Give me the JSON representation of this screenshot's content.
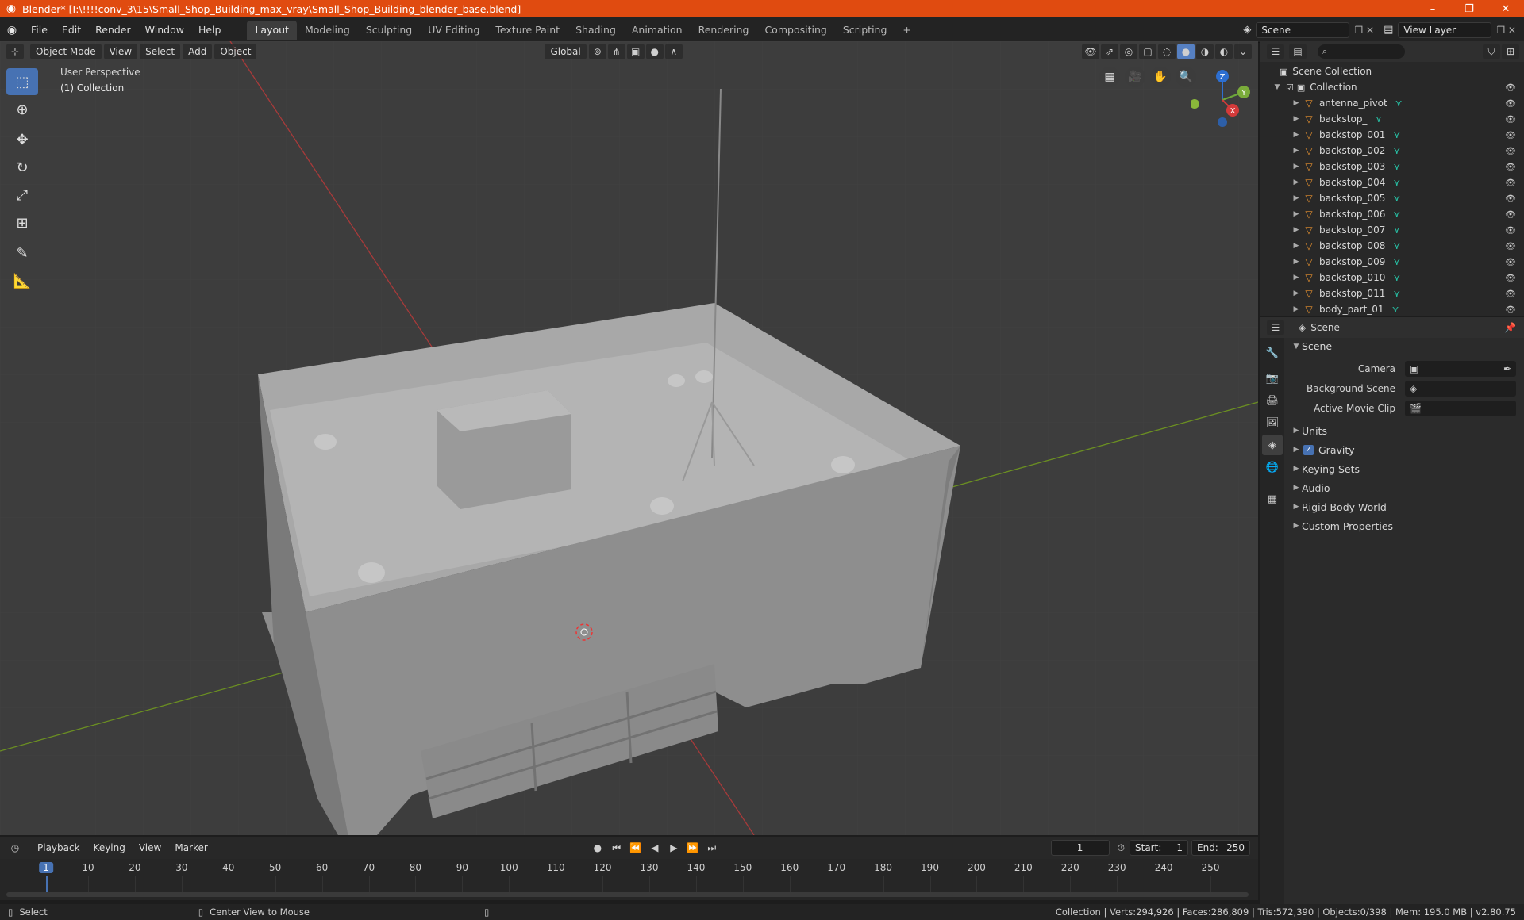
{
  "window": {
    "title": "Blender* [I:\\!!!!conv_3\\15\\Small_Shop_Building_max_vray\\Small_Shop_Building_blender_base.blend]",
    "min": "–",
    "max": "❐",
    "close": "✕"
  },
  "menu": [
    "File",
    "Edit",
    "Render",
    "Window",
    "Help"
  ],
  "workspaces": [
    "Layout",
    "Modeling",
    "Sculpting",
    "UV Editing",
    "Texture Paint",
    "Shading",
    "Animation",
    "Rendering",
    "Compositing",
    "Scripting"
  ],
  "workspace_add": "+",
  "scene_name": "Scene",
  "view_layer": "View Layer",
  "viewport": {
    "mode": "Object Mode",
    "menus": [
      "View",
      "Select",
      "Add",
      "Object"
    ],
    "transform": "Global",
    "perspective": "User Perspective",
    "collection_label": "(1) Collection"
  },
  "gizmo": {
    "x": "X",
    "y": "Y",
    "z": "Z"
  },
  "outliner": {
    "root": "Scene Collection",
    "collection": "Collection",
    "items": [
      "antenna_pivot",
      "backstop_",
      "backstop_001",
      "backstop_002",
      "backstop_003",
      "backstop_004",
      "backstop_005",
      "backstop_006",
      "backstop_007",
      "backstop_008",
      "backstop_009",
      "backstop_010",
      "backstop_011",
      "body_part_01"
    ]
  },
  "properties": {
    "breadcrumb": "Scene",
    "panel": "Scene",
    "rows": [
      {
        "label": "Camera"
      },
      {
        "label": "Background Scene"
      },
      {
        "label": "Active Movie Clip"
      }
    ],
    "sections": [
      "Units",
      "Gravity",
      "Keying Sets",
      "Audio",
      "Rigid Body World",
      "Custom Properties"
    ]
  },
  "timeline": {
    "menus": [
      "Playback",
      "Keying",
      "View",
      "Marker"
    ],
    "current_frame": "1",
    "start_label": "Start:",
    "start": "1",
    "end_label": "End:",
    "end": "250",
    "ticks": [
      "1",
      "10",
      "20",
      "30",
      "40",
      "50",
      "60",
      "70",
      "80",
      "90",
      "100",
      "110",
      "120",
      "130",
      "140",
      "150",
      "160",
      "170",
      "180",
      "190",
      "200",
      "210",
      "220",
      "230",
      "240",
      "250"
    ]
  },
  "status": {
    "select": "Select",
    "center": "Center View to Mouse",
    "stats": "Collection | Verts:294,926 | Faces:286,809 | Tris:572,390 | Objects:0/398 | Mem: 195.0 MB | v2.80.75"
  }
}
